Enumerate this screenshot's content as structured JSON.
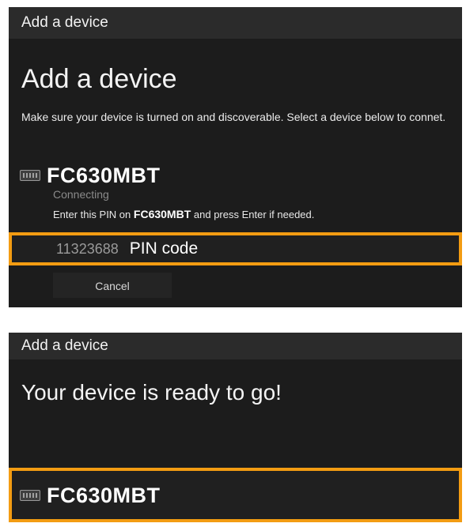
{
  "top_dialog": {
    "window_title": "Add a device",
    "heading": "Add a device",
    "instructions": "Make sure your device is turned on and discoverable. Select a device below to connet.",
    "device": {
      "icon": "keyboard-icon",
      "name": "FC630MBT",
      "status": "Connecting"
    },
    "pin_instruction": {
      "prefix": "Enter this PIN on",
      "device": "FC630MBT",
      "suffix": "and press Enter if needed."
    },
    "pin": {
      "value": "11323688",
      "label": "PIN code"
    },
    "cancel_label": "Cancel"
  },
  "bottom_dialog": {
    "window_title": "Add a device",
    "message": "Your device is ready to go!",
    "device": {
      "icon": "keyboard-icon",
      "name": "FC630MBT"
    }
  },
  "colors": {
    "highlight": "#f39c12",
    "background": "#1c1c1c",
    "titlebar": "#2b2b2b"
  }
}
